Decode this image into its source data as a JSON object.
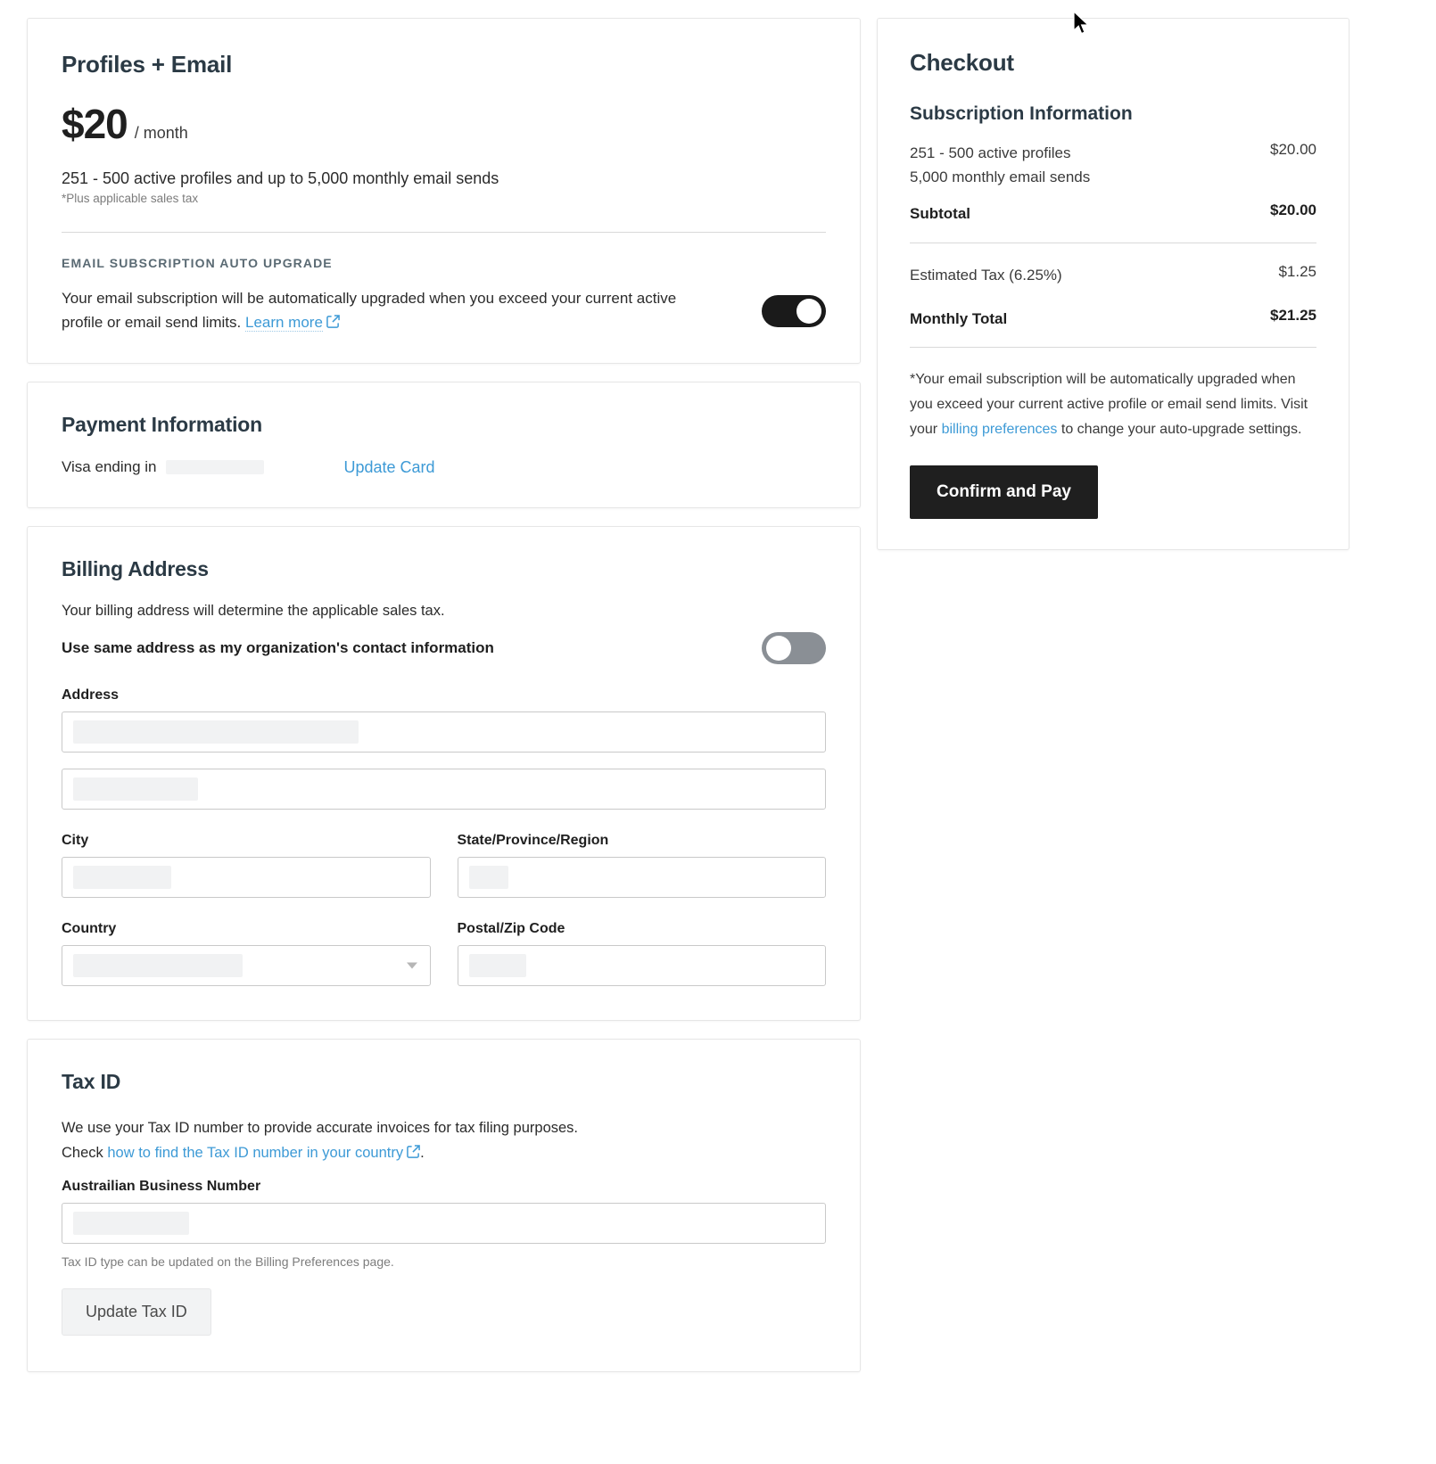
{
  "plan": {
    "title": "Profiles + Email",
    "price_amount": "$20",
    "price_period": "/ month",
    "description": "251 - 500 active profiles and up to 5,000 monthly email sends",
    "tax_note": "*Plus applicable sales tax",
    "auto_upgrade": {
      "eyebrow": "EMAIL SUBSCRIPTION AUTO UPGRADE",
      "text": "Your email subscription will be automatically upgraded when you exceed your current active profile or email send limits.",
      "learn_more_label": "Learn more",
      "toggle_state": "on"
    }
  },
  "payment": {
    "heading": "Payment Information",
    "card_label": "Visa ending in",
    "card_digits": "",
    "update_label": "Update Card"
  },
  "billing": {
    "heading": "Billing Address",
    "subtitle": "Your billing address will determine the applicable sales tax.",
    "same_address_label": "Use same address as my organization's contact information",
    "same_address_toggle_state": "off",
    "fields": [
      {
        "label": "Address",
        "value": "",
        "type": "text"
      },
      {
        "label": "",
        "value": "",
        "type": "text"
      },
      {
        "label": "City",
        "value": "",
        "type": "text"
      },
      {
        "label": "State/Province/Region",
        "value": "",
        "type": "text"
      },
      {
        "label": "Country",
        "value": "",
        "type": "select"
      },
      {
        "label": "Postal/Zip Code",
        "value": "",
        "type": "text"
      }
    ]
  },
  "tax_id": {
    "heading": "Tax ID",
    "description_part1": "We use your Tax ID number to provide accurate invoices for tax filing purposes.",
    "description_check": "Check",
    "link_label": "how to find the Tax ID number in your country",
    "description_end": ".",
    "field_label": "Austrailian Business Number",
    "field_value": "",
    "help_text": "Tax ID type can be updated on the Billing Preferences page.",
    "button_label": "Update Tax ID"
  },
  "checkout": {
    "title": "Checkout",
    "subscription_title": "Subscription Information",
    "line_items": [
      {
        "label": "251 - 500 active profiles\n5,000 monthly email sends",
        "value": "$20.00",
        "bold": false
      }
    ],
    "item_label_line1": "251 - 500 active profiles",
    "item_label_line2": "5,000 monthly email sends",
    "item_value": "$20.00",
    "subtotal_label": "Subtotal",
    "subtotal_value": "$20.00",
    "tax_label": "Estimated Tax (6.25%)",
    "tax_value": "$1.25",
    "total_label": "Monthly Total",
    "total_value": "$21.25",
    "note_part1": "*Your email subscription will be automatically upgraded when you exceed your current active profile or email send limits. Visit your ",
    "note_link": "billing preferences",
    "note_part2": " to change your auto-upgrade settings.",
    "confirm_label": "Confirm and Pay"
  },
  "colors": {
    "accent_link": "#3d9ad6",
    "primary_button": "#1f1f1f",
    "toggle_on": "#1a1a1a",
    "toggle_off": "#8a8f95",
    "heading": "#2b3a45"
  }
}
